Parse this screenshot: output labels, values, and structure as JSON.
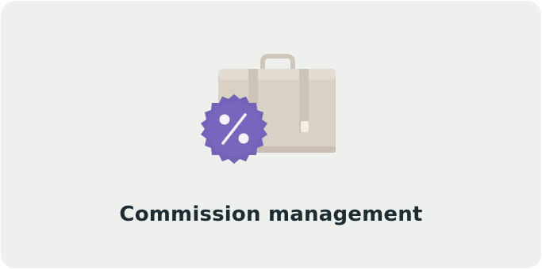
{
  "card": {
    "title": "Commission management",
    "icon": "briefcase-percent-icon",
    "colors": {
      "background": "#eef0ee",
      "title": "#1d2b33",
      "briefcase": "#d9d1c6",
      "briefcase_shadow": "#c9bfb2",
      "badge": "#7461b8",
      "badge_light": "#8a78c8"
    }
  }
}
